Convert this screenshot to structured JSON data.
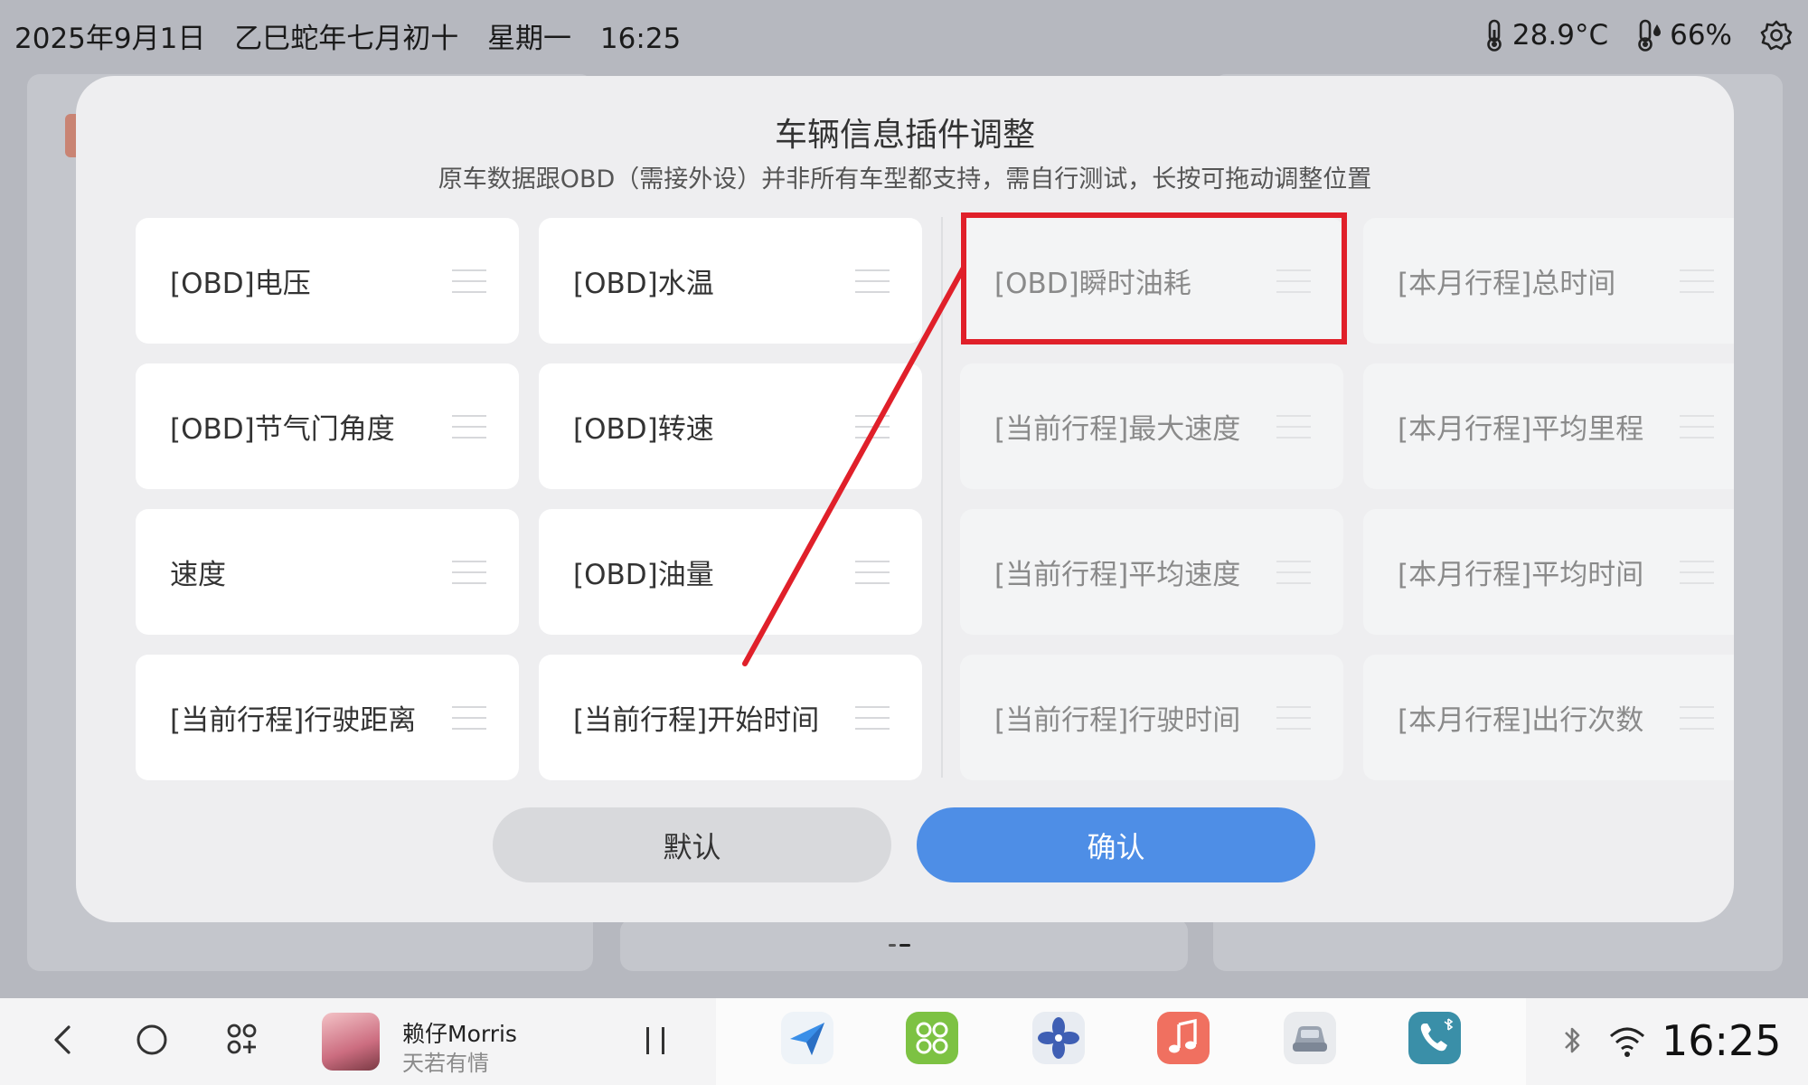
{
  "status_bar": {
    "date": "2025年9月1日",
    "lunar": "乙巳蛇年七月初十",
    "weekday": "星期一",
    "time": "16:25",
    "temperature": "28.9°C",
    "humidity": "66%"
  },
  "dialog": {
    "title": "车辆信息插件调整",
    "subtitle": "原车数据跟OBD（需接外设）并非所有车型都支持，需自行测试，长按可拖动调整位置",
    "active_items": [
      "[OBD]电压",
      "[OBD]水温",
      "[OBD]节气门角度",
      "[OBD]转速",
      "速度",
      "[OBD]油量",
      "[当前行程]行驶距离",
      "[当前行程]开始时间"
    ],
    "inactive_items": [
      "[OBD]瞬时油耗",
      "[本月行程]总时间",
      "[当前行程]最大速度",
      "[本月行程]平均里程",
      "[当前行程]平均速度",
      "[本月行程]平均时间",
      "[当前行程]行驶时间",
      "[本月行程]出行次数"
    ],
    "default_label": "默认",
    "confirm_label": "确认"
  },
  "taskbar": {
    "artist": "赖仔Morris",
    "song": "天若有情",
    "clock": "16:25"
  },
  "colors": {
    "confirm": "#4e8ee6",
    "annotation": "#e0202a"
  }
}
